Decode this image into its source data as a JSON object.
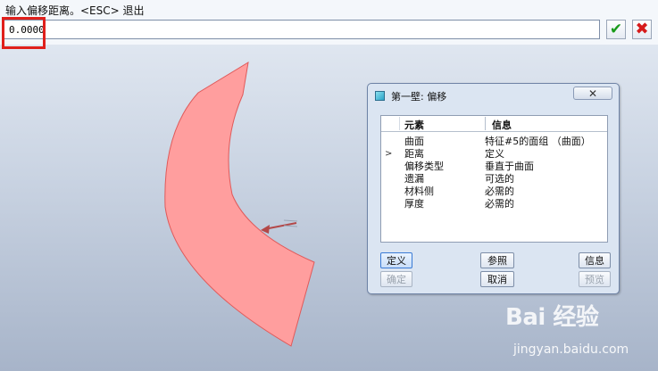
{
  "prompt": {
    "text": "输入偏移距离。<ESC> 退出",
    "input_value": "0.0000"
  },
  "actions": {
    "ok_icon": "check-icon",
    "cancel_icon": "x-icon",
    "ok_color": "#1a9b1a",
    "cancel_color": "#d61a1a"
  },
  "model": {
    "fill_color": "#ff9e9e",
    "edge_color": "#e05a5a"
  },
  "dialog": {
    "title": "第一壁: 偏移",
    "close_glyph": "✕",
    "columns": [
      "元素",
      "信息"
    ],
    "rows": [
      {
        "marker": "",
        "element": "曲面",
        "info": "特征#5的面组 （曲面）"
      },
      {
        "marker": ">",
        "element": "距离",
        "info": "定义"
      },
      {
        "marker": "",
        "element": "偏移类型",
        "info": "垂直于曲面"
      },
      {
        "marker": "",
        "element": "遗漏",
        "info": "可选的"
      },
      {
        "marker": "",
        "element": "材料侧",
        "info": "必需的"
      },
      {
        "marker": "",
        "element": "厚度",
        "info": "必需的"
      }
    ],
    "buttons": {
      "define": "定义",
      "reference": "参照",
      "info": "信息",
      "confirm": "确定",
      "cancel": "取消",
      "preview": "预览"
    }
  },
  "watermark": {
    "logo": "Bai 经验",
    "url": "jingyan.baidu.com"
  }
}
